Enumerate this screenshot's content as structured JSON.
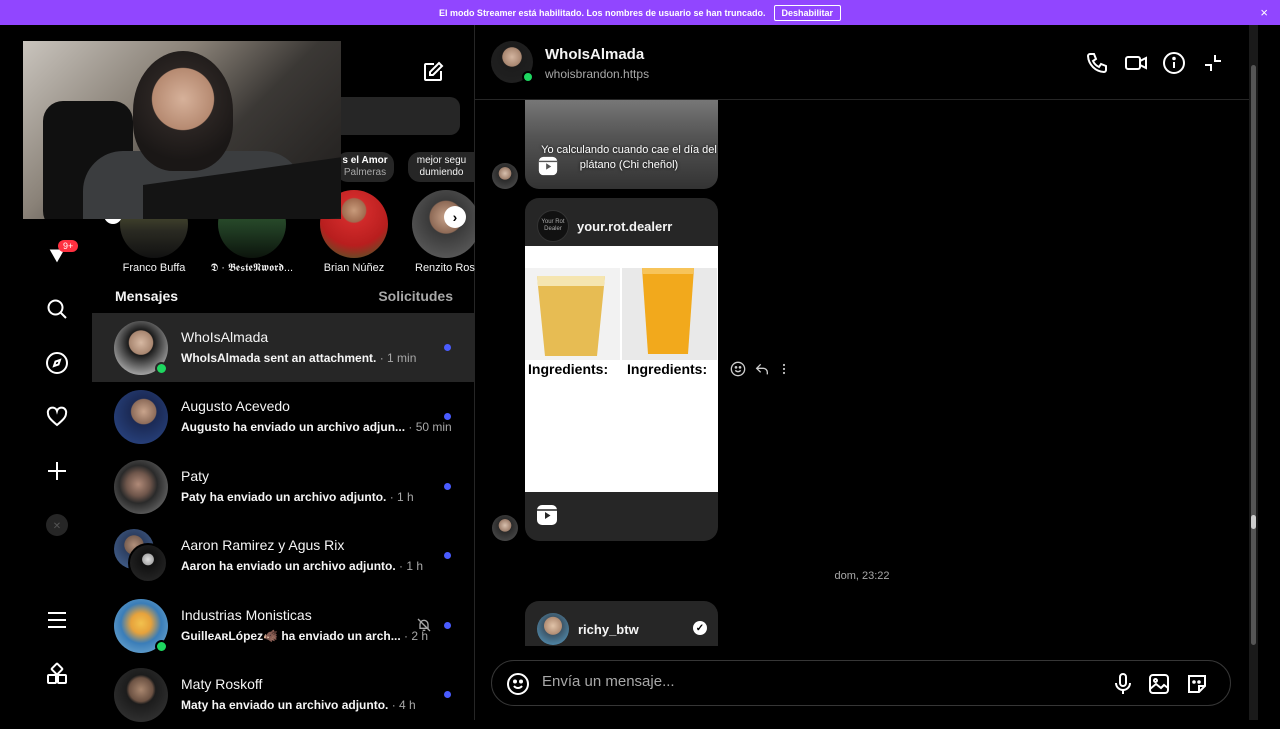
{
  "banner": {
    "text": "El modo Streamer está habilitado. Los nombres de usuario se han truncado.",
    "button": "Deshabilitar",
    "close": "×"
  },
  "rail": {
    "badge": "9+"
  },
  "notes": [
    {
      "title": "s el Amor",
      "sub": "Palmeras"
    },
    {
      "title": "mejor segu",
      "sub": "dumiendo"
    }
  ],
  "stories": [
    {
      "label": "Franco Buffa"
    },
    {
      "label": "𝕯 · 𝕭𝖊𝖘𝖙𝖊𝕹𝖜𝖔𝖗𝖉..."
    },
    {
      "label": "Brian Núñez"
    },
    {
      "label": "Renzito Ros"
    }
  ],
  "tabs": {
    "messages": "Mensajes",
    "requests": "Solicitudes"
  },
  "conversations": [
    {
      "name": "WhoIsAlmada",
      "preview": "WhoIsAlmada sent an attachment.",
      "time": " · 1 min"
    },
    {
      "name": "Augusto Acevedo",
      "preview": "Augusto ha enviado un archivo adjun...",
      "time": " · 50 min"
    },
    {
      "name": "Paty",
      "preview": "Paty ha enviado un archivo adjunto.",
      "time": " · 1 h"
    },
    {
      "name": "Aaron Ramirez y Agus Rix",
      "preview": "Aaron ha enviado un archivo adjunto.",
      "time": " · 1 h"
    },
    {
      "name": "Industrias Monisticas",
      "preview": "GuilleᴀʀLópez🐗 ha enviado un arch...",
      "time": " · 2 h"
    },
    {
      "name": "Maty Roskoff",
      "preview": "Maty ha enviado un archivo adjunto.",
      "time": " · 4 h"
    }
  ],
  "chat": {
    "title": "WhoIsAlmada",
    "subtitle": "whoisbrandon.https",
    "reel_caption": "Yo calculando cuando cae el día del plátano (Chi cheñol)",
    "post_user": "your.rot.dealerr",
    "post_avatar_text": "Your Rot Dealer",
    "ingredients_left": "Ingredients:",
    "ingredients_right": "Ingredients:",
    "date": "dom, 23:22",
    "share_user": "richy_btw",
    "verified": "✓"
  },
  "composer": {
    "placeholder": "Envía un mensaje..."
  },
  "colors": {
    "banner": "#9146ff",
    "unread_dot": "#4a5cff",
    "online": "#1ed760"
  }
}
